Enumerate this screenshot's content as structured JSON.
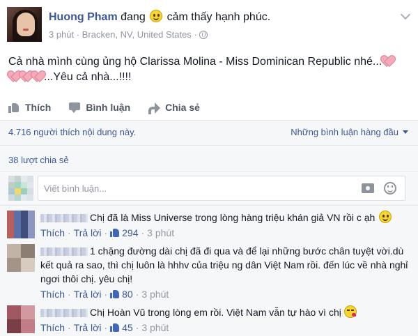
{
  "post": {
    "author": "Huong Pham",
    "feeling_prefix": "đang",
    "feeling_text": "cảm thấy hạnh phúc.",
    "time": "3 phút",
    "location": "Bracken, NV, United States",
    "separator": "·",
    "text_line1": "Cả nhà mình cùng ủng hộ Clarissa Molina - Miss Dominican Republic nhé...",
    "text_line2": "...Yêu cả nhà...!!!!",
    "accent_color": "#3b5998"
  },
  "actions": {
    "like_label": "Thích",
    "comment_label": "Bình luận",
    "share_label": "Chia sẻ"
  },
  "summary": {
    "likes_text": "4.716 người thích nội dung này.",
    "sort_label": "Những bình luận hàng đầu",
    "shares_text": "38 lượt chia sẻ"
  },
  "composer": {
    "placeholder": "Viết bình luận..."
  },
  "comments": [
    {
      "text": "Chị đã là Miss Universe trong lòng hàng triệu khán giả VN rồi c ạh",
      "like_label": "Thích",
      "reply_label": "Trả lời",
      "likes": "294",
      "time": "3 phút"
    },
    {
      "text": "1 chặng đường dài chị đã đi qua và để lại những bước chân tuyệt vời.dù kết quả ra sao, thì chị luôn là hhhv của triệu ng dân Việt Nam rồi. đến lúc về nhà nghỉ ngơi thôi chị. yêu chị!",
      "like_label": "Thích",
      "reply_label": "Trả lời",
      "likes": "80",
      "time": "3 phút"
    },
    {
      "text": "Chị Hoàn Vũ trong lòng em rồi. Việt Nam vẫn tự hào vì chị",
      "like_label": "Thích",
      "reply_label": "Trả lời",
      "likes": "45",
      "time": "3 phút"
    }
  ]
}
